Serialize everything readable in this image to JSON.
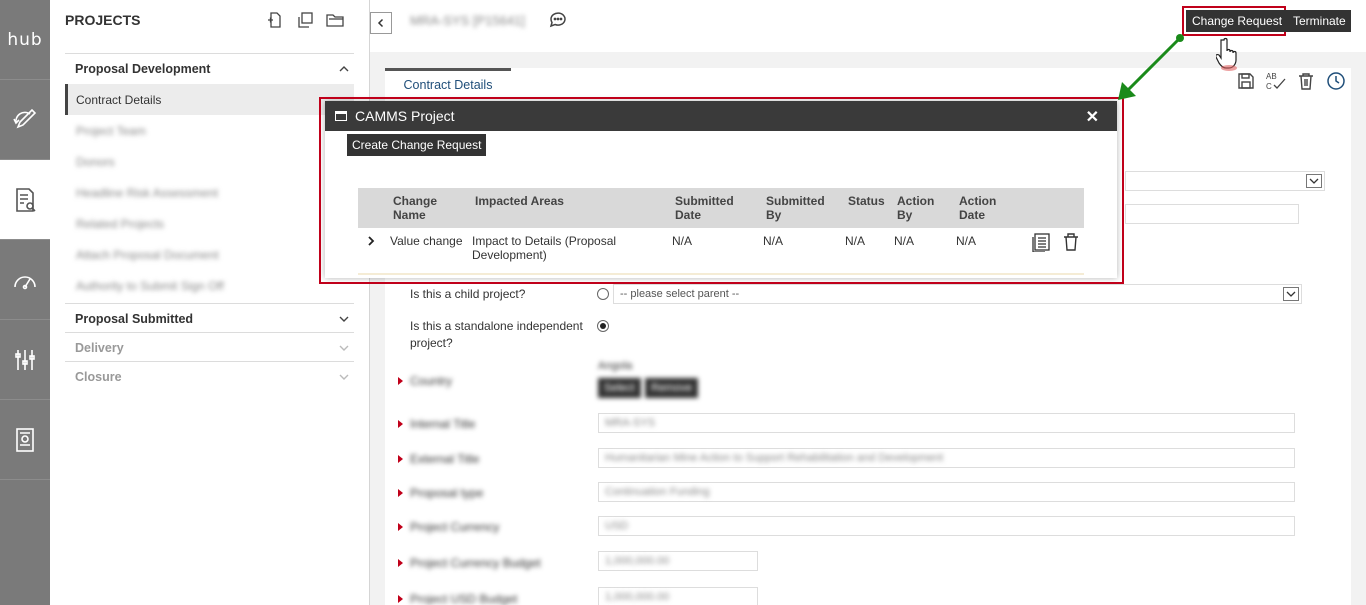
{
  "rail": {
    "logo": "hub",
    "items": [
      {
        "icon": "hub-logo"
      },
      {
        "icon": "pencil-cycle-icon"
      },
      {
        "icon": "document-search-icon"
      },
      {
        "icon": "gauge-icon"
      },
      {
        "icon": "sliders-icon"
      },
      {
        "icon": "report-book-icon"
      }
    ]
  },
  "projects": {
    "title": "PROJECTS",
    "tools": [
      "add-file-icon",
      "copy-icon",
      "folder-icon"
    ],
    "sections": [
      {
        "label": "Proposal Development",
        "expanded": true,
        "items": [
          "Contract Details",
          "Project Team",
          "Donors",
          "Headline Risk Assessment",
          "Related Projects",
          "Attach Proposal Document",
          "Authority to Submit Sign Off"
        ]
      },
      {
        "label": "Proposal Submitted",
        "expanded": false
      },
      {
        "label": "Delivery",
        "expanded": false
      },
      {
        "label": "Closure",
        "expanded": false
      }
    ]
  },
  "header": {
    "project_name": "MRA-SYS [P15641]",
    "change_request_label": "Change Request",
    "terminate_label": "Terminate"
  },
  "tab": {
    "label": "Contract Details"
  },
  "toolbar": [
    "save-icon",
    "spellcheck-icon",
    "delete-icon",
    "history-icon"
  ],
  "form": {
    "child_project_label": "Is this a child project?",
    "parent_placeholder": "-- please select parent --",
    "standalone_label": "Is this a standalone independent project?",
    "country_label": "Country",
    "country_value": "Angola",
    "select_label": "Select",
    "remove_label": "Remove",
    "internal_title_label": "Internal Title",
    "internal_title_value": "MRA-SYS",
    "external_title_label": "External Title",
    "external_title_value": "Humanitarian Mine Action to Support Rehabilitation and Development",
    "proposal_type_label": "Proposal type",
    "proposal_type_value": "Continuation Funding",
    "project_currency_label": "Project Currency",
    "project_currency_value": "USD",
    "currency_budget_label": "Project Currency Budget",
    "currency_budget_value": "1,000,000.00",
    "usd_budget_label": "Project USD Budget",
    "usd_budget_value": "1,000,000.00"
  },
  "modal": {
    "title": "CAMMS Project",
    "create_label": "Create Change Request",
    "columns": [
      "Change Name",
      "Impacted Areas",
      "Submitted Date",
      "Submitted By",
      "Status",
      "Action By",
      "Action Date"
    ],
    "rows": [
      {
        "change_name": "Value change",
        "impacted_areas": "Impact to Details (Proposal Development)",
        "submitted_date": "N/A",
        "submitted_by": "N/A",
        "status": "N/A",
        "action_by": "N/A",
        "action_date": "N/A"
      }
    ]
  },
  "colors": {
    "highlight": "#c0001a",
    "arrow": "#1a8a1a",
    "dark_button": "#333333"
  }
}
